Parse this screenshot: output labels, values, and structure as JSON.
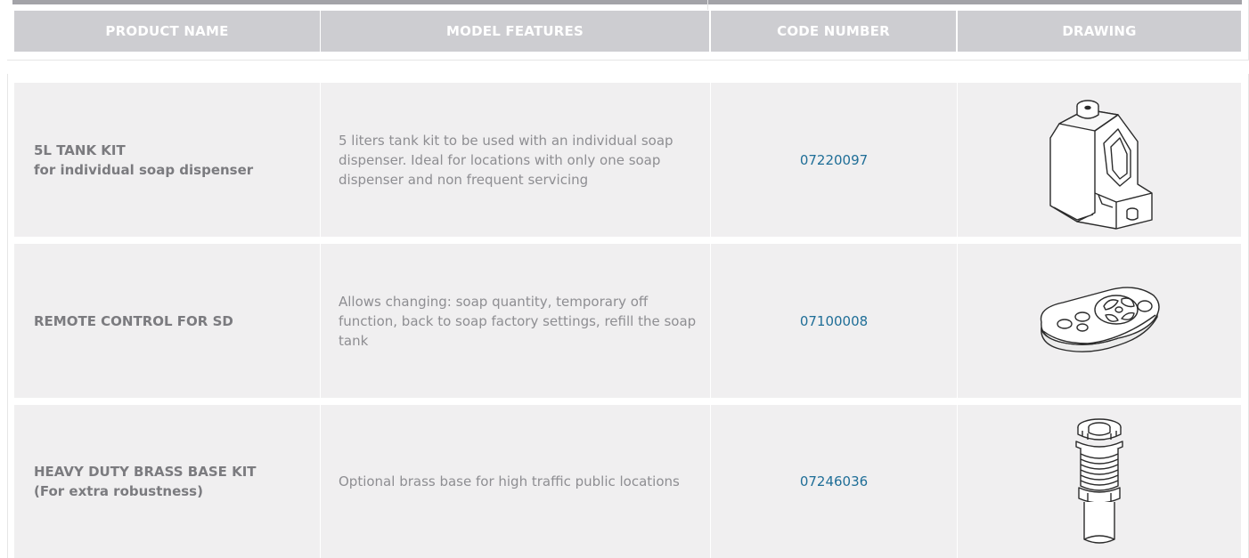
{
  "table": {
    "headers": {
      "product_name": "PRODUCT NAME",
      "model_features": "MODEL FEATURES",
      "code_number": "CODE NUMBER",
      "drawing": "DRAWING"
    },
    "rows": [
      {
        "name_line1": "5L TANK KIT",
        "name_line2": "for individual soap dispenser",
        "features": "5 liters tank kit to be used with an individual soap dispenser. Ideal for locations with only one soap dispenser and non frequent servicing",
        "code": "07220097",
        "drawing_icon": "tank-drawing-icon"
      },
      {
        "name_line1": "REMOTE CONTROL FOR SD",
        "name_line2": "",
        "features": "Allows changing: soap quantity, temporary off function, back to soap factory settings, refill the soap tank",
        "code": "07100008",
        "drawing_icon": "remote-control-drawing-icon"
      },
      {
        "name_line1": "HEAVY DUTY BRASS BASE KIT",
        "name_line2": "(For extra robustness)",
        "features": "Optional brass base for high traffic public locations",
        "code": "07246036",
        "drawing_icon": "brass-base-drawing-icon"
      }
    ]
  },
  "colors": {
    "header_bg": "#cdcdd1",
    "header_text": "#ffffff",
    "cell_bg": "#f0eff0",
    "name_text": "#7b7b7f",
    "feature_text": "#8e8e92",
    "code_link": "#1f6e97",
    "topline": "#a3a3a8"
  }
}
